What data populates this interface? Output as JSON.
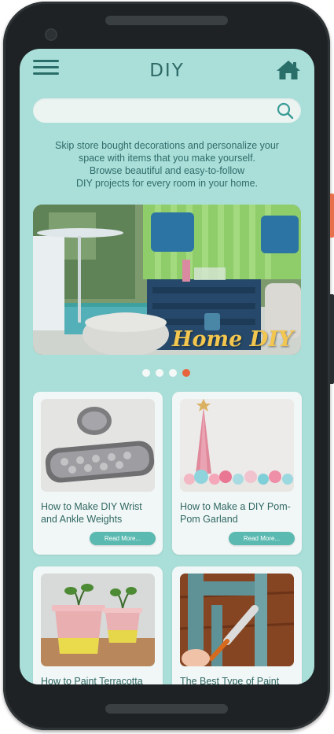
{
  "app": {
    "title": "DIY"
  },
  "search": {
    "placeholder": "",
    "value": ""
  },
  "intro": {
    "lines": [
      "Skip store bought decorations and personalize your",
      "space with items that you make yourself.",
      "Browse beautiful and easy-to-follow",
      "DIY projects for every room in your home."
    ]
  },
  "hero": {
    "caption": "Home DIY"
  },
  "carousel": {
    "dot_count": 4,
    "active_index": 3
  },
  "projects": [
    {
      "title": "How to Make DIY Wrist and Ankle Weights",
      "button": "Read More..."
    },
    {
      "title": "How to Make a DIY Pom-Pom Garland",
      "button": "Read More..."
    },
    {
      "title": "How to Paint Terracotta",
      "button": ""
    },
    {
      "title": "The Best Type of Paint",
      "button": ""
    }
  ],
  "colors": {
    "screen_bg": "#aadfd9",
    "accent": "#5ab9b0",
    "text": "#2f6b6a",
    "active_dot": "#e8643c",
    "caption": "#f3c74f"
  }
}
